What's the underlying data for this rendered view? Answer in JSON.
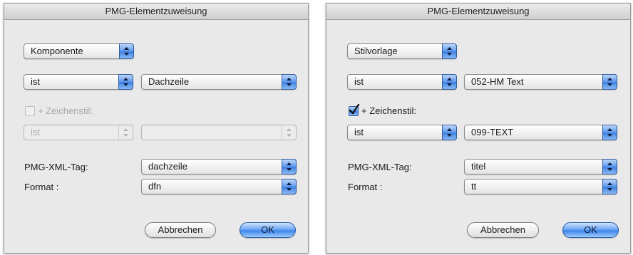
{
  "left": {
    "title": "PMG-Elementzuweisung",
    "type_select": "Komponente",
    "cond1_op": "ist",
    "cond1_value": "Dachzeile",
    "charstyle_label": "+ Zeichenstil:",
    "charstyle_checked": false,
    "charstyle_enabled": false,
    "cond2_op": "ist",
    "cond2_value": "",
    "tag_label": "PMG-XML-Tag:",
    "tag_value": "dachzeile",
    "format_label": "Format :",
    "format_value": "dfn",
    "cancel_label": "Abbrechen",
    "ok_label": "OK"
  },
  "right": {
    "title": "PMG-Elementzuweisung",
    "type_select": "Stilvorlage",
    "cond1_op": "ist",
    "cond1_value": "052-HM Text",
    "charstyle_label": "+ Zeichenstil:",
    "charstyle_checked": true,
    "charstyle_enabled": true,
    "cond2_op": "ist",
    "cond2_value": "099-TEXT",
    "tag_label": "PMG-XML-Tag:",
    "tag_value": "titel",
    "format_label": "Format :",
    "format_value": "tt",
    "cancel_label": "Abbrechen",
    "ok_label": "OK"
  },
  "colors": {
    "accent": "#3c7fe0",
    "window_bg": "#e9e9e9"
  }
}
